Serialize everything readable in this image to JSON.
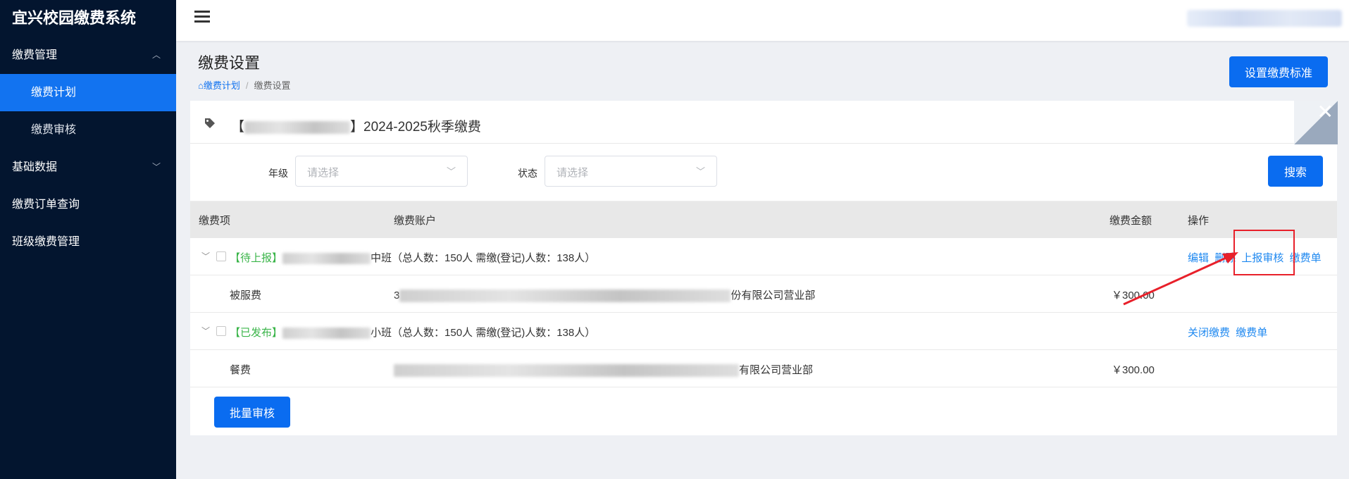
{
  "app": {
    "title": "宜兴校园缴费系统"
  },
  "sidebar": {
    "items": [
      {
        "label": "缴费管理",
        "type": "parent",
        "chevron": "up"
      },
      {
        "label": "缴费计划",
        "type": "sub",
        "active": true
      },
      {
        "label": "缴费审核",
        "type": "sub"
      },
      {
        "label": "基础数据",
        "type": "parent",
        "chevron": "down"
      },
      {
        "label": "缴费订单查询",
        "type": "parent"
      },
      {
        "label": "班级缴费管理",
        "type": "parent"
      }
    ]
  },
  "header": {
    "page_title": "缴费设置",
    "breadcrumb": {
      "home": "缴费计划",
      "current": "缴费设置",
      "separator": "/"
    },
    "set_standard_button": "设置缴费标准"
  },
  "card": {
    "title_prefix": "【",
    "title_suffix": "】2024-2025秋季缴费",
    "close_glyph": "✕"
  },
  "filters": {
    "grade_label": "年级",
    "grade_placeholder": "请选择",
    "status_label": "状态",
    "status_placeholder": "请选择",
    "search_button": "搜索"
  },
  "table": {
    "columns": [
      "缴费项",
      "缴费账户",
      "缴费金额",
      "操作"
    ],
    "groups": [
      {
        "status": "【待上报】",
        "class_suffix": "中班",
        "summary": "（总人数：150人 需缴(登记)人数：138人）",
        "actions": [
          "编辑",
          "删除",
          "上报审核",
          "缴费单"
        ],
        "item": {
          "name": "被服费",
          "account_prefix": "3",
          "account_suffix": "份有限公司营业部",
          "amount": "￥300.00"
        }
      },
      {
        "status": "【已发布】",
        "class_suffix": "小班",
        "summary": "（总人数：150人 需缴(登记)人数：138人）",
        "actions": [
          "关闭缴费",
          "缴费单"
        ],
        "item": {
          "name": "餐费",
          "account_prefix": "",
          "account_suffix": "有限公司营业部",
          "amount": "￥300.00"
        }
      }
    ]
  },
  "batch_button": "批量审核",
  "colors": {
    "sidebar_bg": "#03152f",
    "accent": "#1273f0",
    "status_green": "#3bb54a",
    "link": "#1e88f0",
    "annotation_red": "#e8202a"
  },
  "icons": [
    "menu-toggle-icon",
    "tag-icon",
    "chevron-up-icon",
    "chevron-down-icon",
    "close-icon",
    "home-icon"
  ]
}
